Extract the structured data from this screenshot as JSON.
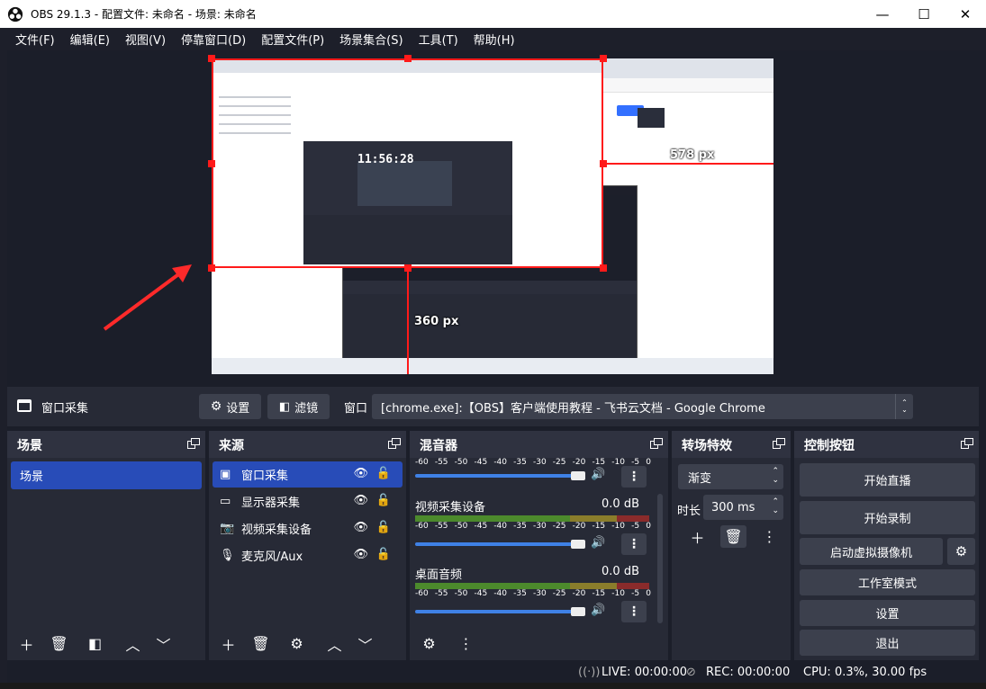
{
  "window": {
    "title": "OBS 29.1.3 - 配置文件: 未命名 - 场景: 未命名",
    "minimize": "—",
    "maximize": "☐",
    "close": "✕"
  },
  "menu": [
    "文件(F)",
    "编辑(E)",
    "视图(V)",
    "停靠窗口(D)",
    "配置文件(P)",
    "场景集合(S)",
    "工具(T)",
    "帮助(H)"
  ],
  "preview": {
    "width_label": "578 px",
    "height_label": "360 px",
    "mini_clock": "11:56:28"
  },
  "source_toolbar": {
    "source_name": "窗口采集",
    "settings_label": "设置",
    "filters_label": "滤镜",
    "window_label": "窗口",
    "window_value": "[chrome.exe]:【OBS】客户端使用教程 - 飞书云文档 - Google Chrome"
  },
  "docks": {
    "scenes": {
      "title": "场景",
      "items": [
        "场景"
      ]
    },
    "sources": {
      "title": "来源",
      "items": [
        {
          "label": "窗口采集",
          "icon": "window-icon"
        },
        {
          "label": "显示器采集",
          "icon": "monitor-icon"
        },
        {
          "label": "视频采集设备",
          "icon": "camera-icon"
        },
        {
          "label": "麦克风/Aux",
          "icon": "microphone-icon"
        }
      ]
    },
    "mixer": {
      "title": "混音器",
      "ticks": [
        "-60",
        "-55",
        "-50",
        "-45",
        "-40",
        "-35",
        "-30",
        "-25",
        "-20",
        "-15",
        "-10",
        "-5",
        "0"
      ],
      "channels": [
        {
          "name": "视频采集设备",
          "db": "0.0 dB",
          "volume": 1.0
        },
        {
          "name": "桌面音频",
          "db": "0.0 dB",
          "volume": 1.0
        }
      ]
    },
    "transitions": {
      "title": "转场特效",
      "selected": "渐变",
      "duration_label": "时长",
      "duration_value": "300 ms"
    },
    "controls": {
      "title": "控制按钮",
      "start_stream": "开始直播",
      "start_record": "开始录制",
      "virtual_cam": "启动虚拟摄像机",
      "studio_mode": "工作室模式",
      "settings": "设置",
      "exit": "退出"
    }
  },
  "status": {
    "live": "LIVE: 00:00:00",
    "rec": "REC: 00:00:00",
    "cpu": "CPU: 0.3%, 30.00 fps"
  }
}
